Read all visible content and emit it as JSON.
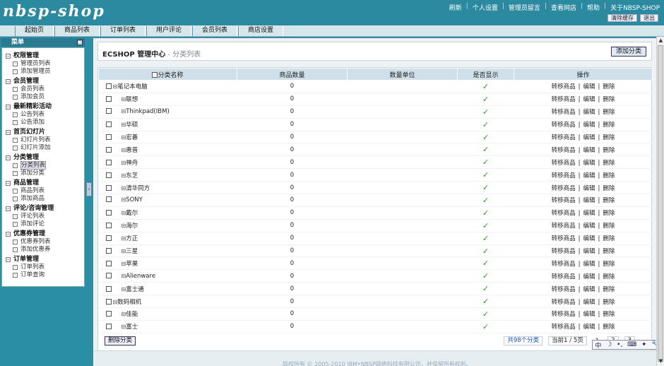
{
  "header": {
    "logo": "nbsp-shop",
    "nav": [
      "刷新",
      "个人设置",
      "管理员留言",
      "查看网店",
      "帮助",
      "关于NBSP-SHOP"
    ],
    "buttons": [
      "清除缓存",
      "退出"
    ]
  },
  "menubar": {
    "tabs": [
      "起始页",
      "商品列表",
      "订单列表",
      "用户评论",
      "会员列表",
      "商店设置"
    ]
  },
  "sidebar": {
    "title": "菜单",
    "toggle": "□",
    "groups": [
      {
        "title": "权限管理",
        "items": [
          "管理员列表",
          "添加管理员"
        ]
      },
      {
        "title": "会员管理",
        "items": [
          "会员列表",
          "添加会员"
        ]
      },
      {
        "title": "最新精彩活动",
        "items": [
          "公告列表",
          "公告添加"
        ]
      },
      {
        "title": "首页幻灯片",
        "items": [
          "幻灯片列表",
          "幻灯片添加"
        ]
      },
      {
        "title": "分类管理",
        "items": [
          "分类列表",
          "添加分类"
        ]
      },
      {
        "title": "商品管理",
        "items": [
          "商品列表",
          "添加商品"
        ]
      },
      {
        "title": "评论/咨询管理",
        "items": [
          "评论列表",
          "添加评论"
        ]
      },
      {
        "title": "优惠券管理",
        "items": [
          "优惠券列表",
          "添加优惠券"
        ]
      },
      {
        "title": "订单管理",
        "items": [
          "订单列表",
          "订单查询"
        ]
      }
    ],
    "active_item": "分类列表",
    "collapse_glyph": "‹"
  },
  "main": {
    "title": "ECSHOP 管理中心",
    "subtitle": " - 分类列表",
    "add_button": "添加分类",
    "table": {
      "headers": [
        "分类名称",
        "商品数量",
        "数量单位",
        "是否显示",
        "操作"
      ],
      "rows": [
        {
          "name": "笔记本电脑",
          "level": 0,
          "count": "0",
          "unit": "",
          "show": "✓"
        },
        {
          "name": "联想",
          "level": 1,
          "count": "0",
          "unit": "",
          "show": "✓"
        },
        {
          "name": "Thinkpad(IBM)",
          "level": 1,
          "count": "0",
          "unit": "",
          "show": "✓"
        },
        {
          "name": "华硕",
          "level": 1,
          "count": "0",
          "unit": "",
          "show": "✓"
        },
        {
          "name": "宏碁",
          "level": 1,
          "count": "0",
          "unit": "",
          "show": "✓"
        },
        {
          "name": "惠普",
          "level": 1,
          "count": "0",
          "unit": "",
          "show": "✓"
        },
        {
          "name": "神舟",
          "level": 1,
          "count": "0",
          "unit": "",
          "show": "✓"
        },
        {
          "name": "东芝",
          "level": 1,
          "count": "0",
          "unit": "",
          "show": "✓"
        },
        {
          "name": "清华同方",
          "level": 1,
          "count": "0",
          "unit": "",
          "show": "✓"
        },
        {
          "name": "SONY",
          "level": 1,
          "count": "0",
          "unit": "",
          "show": "✓"
        },
        {
          "name": "戴尔",
          "level": 1,
          "count": "0",
          "unit": "",
          "show": "✓"
        },
        {
          "name": "海尔",
          "level": 1,
          "count": "0",
          "unit": "",
          "show": "✓"
        },
        {
          "name": "方正",
          "level": 1,
          "count": "0",
          "unit": "",
          "show": "✓"
        },
        {
          "name": "三星",
          "level": 1,
          "count": "0",
          "unit": "",
          "show": "✓"
        },
        {
          "name": "苹果",
          "level": 1,
          "count": "0",
          "unit": "",
          "show": "✓"
        },
        {
          "name": "Alienware",
          "level": 1,
          "count": "0",
          "unit": "",
          "show": "✓"
        },
        {
          "name": "富士通",
          "level": 1,
          "count": "0",
          "unit": "",
          "show": "✓"
        },
        {
          "name": "数码相机",
          "level": 0,
          "count": "0",
          "unit": "",
          "show": "✓"
        },
        {
          "name": "佳能",
          "level": 1,
          "count": "0",
          "unit": "",
          "show": "✓"
        },
        {
          "name": "富士",
          "level": 1,
          "count": "0",
          "unit": "",
          "show": "✓"
        }
      ],
      "ops": [
        "转移商品",
        "编辑",
        "删除"
      ],
      "ops_sep": "|",
      "tree_glyph": "⊟"
    },
    "delete_button": "删除分类",
    "pager": {
      "total": "共98个分类",
      "current": "当前1 / 5页",
      "pages": [
        "1",
        "2",
        "3"
      ]
    }
  },
  "footer": {
    "copyright": "版权所有 © 2005-2010 IBM•NBSP网络科技有限公司，并保留所有权利。"
  },
  "ime": {
    "items": [
      "中",
      "☽",
      "•,",
      "⌨",
      "✦",
      "🔧"
    ]
  },
  "scrollbar": {
    "up": "▲",
    "down": "▼"
  }
}
